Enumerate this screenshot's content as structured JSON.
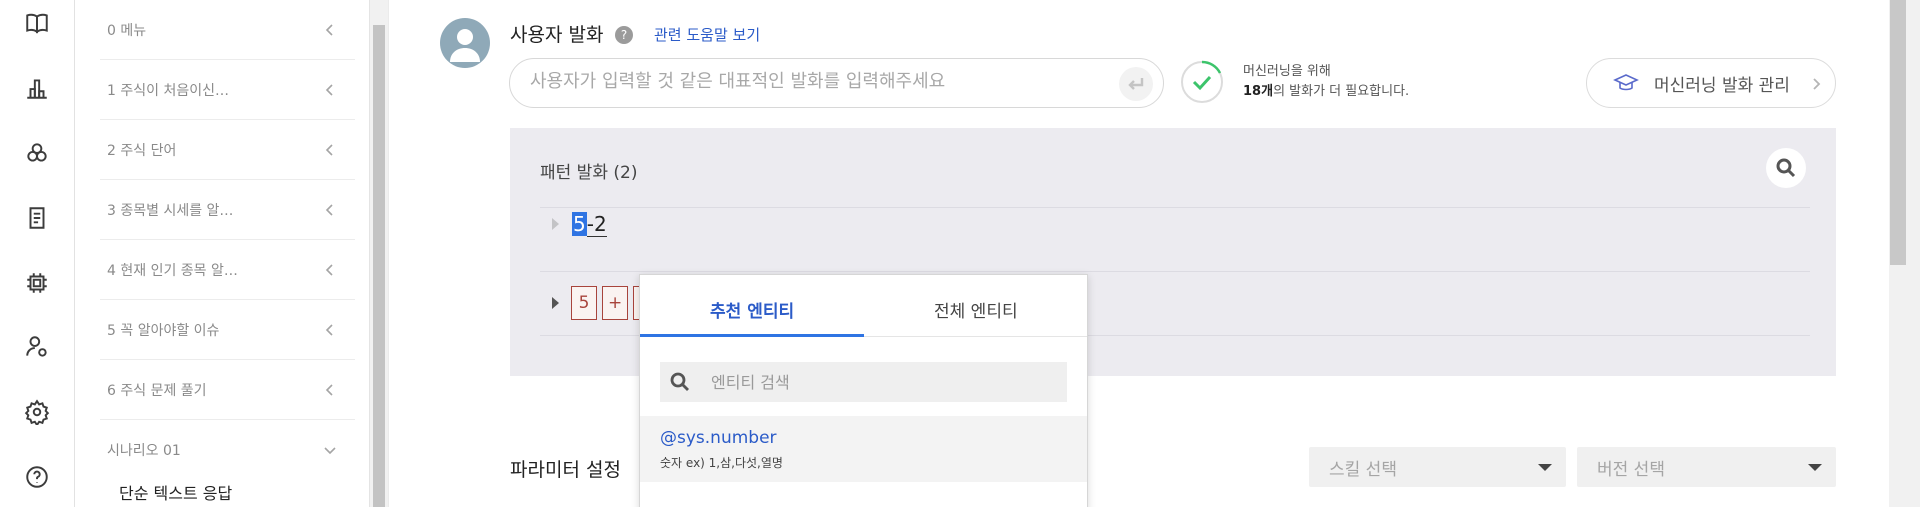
{
  "rail": {
    "icons": [
      "book-icon",
      "bar-chart-icon",
      "cluster-icon",
      "document-icon",
      "chip-icon",
      "user-settings-icon",
      "gear-icon",
      "help-circle-icon"
    ]
  },
  "menu": {
    "items": [
      {
        "label": "0 메뉴"
      },
      {
        "label": "1 주식이 처음이신…"
      },
      {
        "label": "2 주식 단어"
      },
      {
        "label": "3 종목별 시세를 알…"
      },
      {
        "label": "4 현재 인기 종목 알…"
      },
      {
        "label": "5 꼭 알아야할 이슈"
      },
      {
        "label": "6 주식 문제 풀기"
      },
      {
        "label": "시나리오 01"
      }
    ],
    "submenu_label": "단순 텍스트 응답"
  },
  "user_utterance": {
    "title": "사용자 발화",
    "help_icon_text": "?",
    "help_link": "관련 도움말 보기",
    "input_placeholder": "사용자가 입력할 것 같은 대표적인 발화를 입력해주세요",
    "input_value": ""
  },
  "ml_status": {
    "line1": "머신러닝을 위해",
    "count": "18개",
    "line2_rest": "의 발화가 더 필요합니다.",
    "manage_button": "머신러닝 발화 관리",
    "accent": "#3cc46b"
  },
  "pattern": {
    "title": "패턴 발화 (2)",
    "rows": [
      {
        "selected": "5",
        "rest": "-2"
      },
      {
        "tokens": [
          "5",
          "+",
          ""
        ]
      }
    ]
  },
  "entity_popup": {
    "tabs": [
      "추천 엔티티",
      "전체 엔티티"
    ],
    "search_placeholder": "엔티티 검색",
    "entities": [
      {
        "name": "@sys.number",
        "desc": "숫자 ex) 1,삼,다섯,열명"
      }
    ],
    "accent": "#2f74e3"
  },
  "params": {
    "title": "파라미터 설정",
    "skill_select": "스킬 선택",
    "version_select": "버전 선택"
  }
}
